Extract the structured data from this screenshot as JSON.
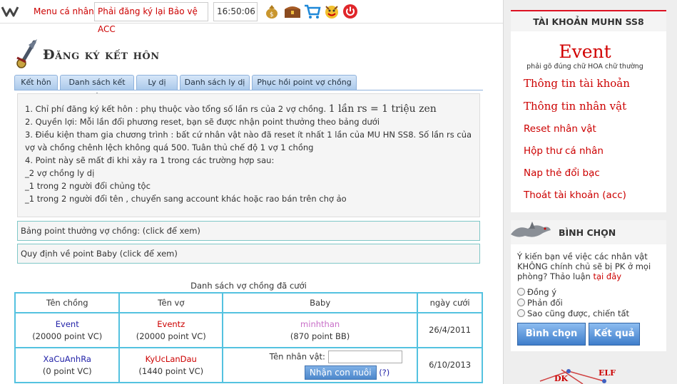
{
  "topbar": {
    "logo_icon": "w-logo-icon",
    "menu_label": "Menu cá nhân",
    "notice": "Phải đăng ký lại Bảo vệ ACC",
    "clock": "16:50:06",
    "icons": [
      "money-bag-icon",
      "treasure-chest-icon",
      "shopping-cart-icon",
      "reward-face-icon",
      "power-icon"
    ]
  },
  "page": {
    "title": "Đăng ký kết hôn"
  },
  "tabs": [
    {
      "label": "Kết hôn"
    },
    {
      "label": "Danh sách kết hôn"
    },
    {
      "label": "Ly dị"
    },
    {
      "label": "Danh sách ly dị"
    },
    {
      "label": "Phục hồi point vợ chồng"
    }
  ],
  "info": {
    "line1_text": "1. Chỉ phí đăng ký kết hôn : phụ thuộc vào tổng số lần rs của 2 vợ chồng.",
    "line1_big": "1 lần rs = 1 triệu zen",
    "line2": "2. Quyền lợi: Mỗi lần đổi phương reset, bạn sẽ được nhận point thưởng theo bảng dưới",
    "line3": "3. Điều kiện tham gia chương trình : bất cứ nhân vật nào đã reset ít nhất 1 lần của MU HN SS8. Số lần rs của vợ và chồng chênh lệch không quá 500. Tuân thủ chế độ 1 vợ 1 chồng",
    "line4": "4. Point này sẽ mất đi khi xảy ra 1 trong các trường hợp sau:",
    "line5": "_2 vợ chồng ly dị",
    "line6": "_1 trong 2 người đổi chủng tộc",
    "line7": "_1 trong 2 người đổi tên , chuyển sang account khác hoặc rao bán trên chợ ảo"
  },
  "links": {
    "reward_table": "Bảng point thưởng vợ chồng: (click để xem)",
    "baby_rules": "Quy định về point Baby (click để xem)"
  },
  "table": {
    "caption": "Danh sách vợ chồng đã cưới",
    "headers": [
      "Tên chồng",
      "Tên vợ",
      "Baby",
      "ngày cưới"
    ],
    "rows": [
      {
        "husband": "Event",
        "husband_point": "(20000 point VC)",
        "wife": "Eventz",
        "wife_point": "(20000 point VC)",
        "baby": "minhthan",
        "baby_point": "(870 point BB)",
        "date": "26/4/2011"
      },
      {
        "husband": "XaCuAnhRa",
        "husband_point": "(0 point VC)",
        "wife": "KyUcLanDau",
        "wife_point": "(1440 point VC)",
        "baby_label": "Tên nhân vật:",
        "baby_input_value": "",
        "baby_button": "Nhận con nuôi",
        "baby_help": "(?)",
        "date": "6/10/2013"
      }
    ]
  },
  "sidebar": {
    "header": "TÀI KHOẢN MUHN SS8",
    "event_title": "Event",
    "event_sub": "phải gõ đúng chữ HOA chữ thường",
    "links": [
      "Thông tin tài khoản",
      "Thông tin nhân vật",
      "Reset nhân vật",
      "Hộp thư cá nhân",
      "Nap thẻ đổi bạc",
      "Thoát tài khoản (acc)"
    ]
  },
  "poll": {
    "title": "BÌNH CHỌN",
    "question_text": "Ý kiến bạn về việc các nhân vật KHÔNG chính chủ sẽ bị PK ở mọi phòng? Thảo luận",
    "question_link": "tại đây",
    "options": [
      "Đồng ý",
      "Phản đối",
      "Sao cũng được, chiến tất"
    ],
    "vote_button": "Bình chọn",
    "result_button": "Kết quả"
  },
  "banner": {
    "labels": [
      "DK",
      "ELF"
    ]
  },
  "colors": {
    "accent_red": "#cc0000",
    "table_border": "#54c2e0",
    "tab_blue": "#a9c8ea"
  }
}
